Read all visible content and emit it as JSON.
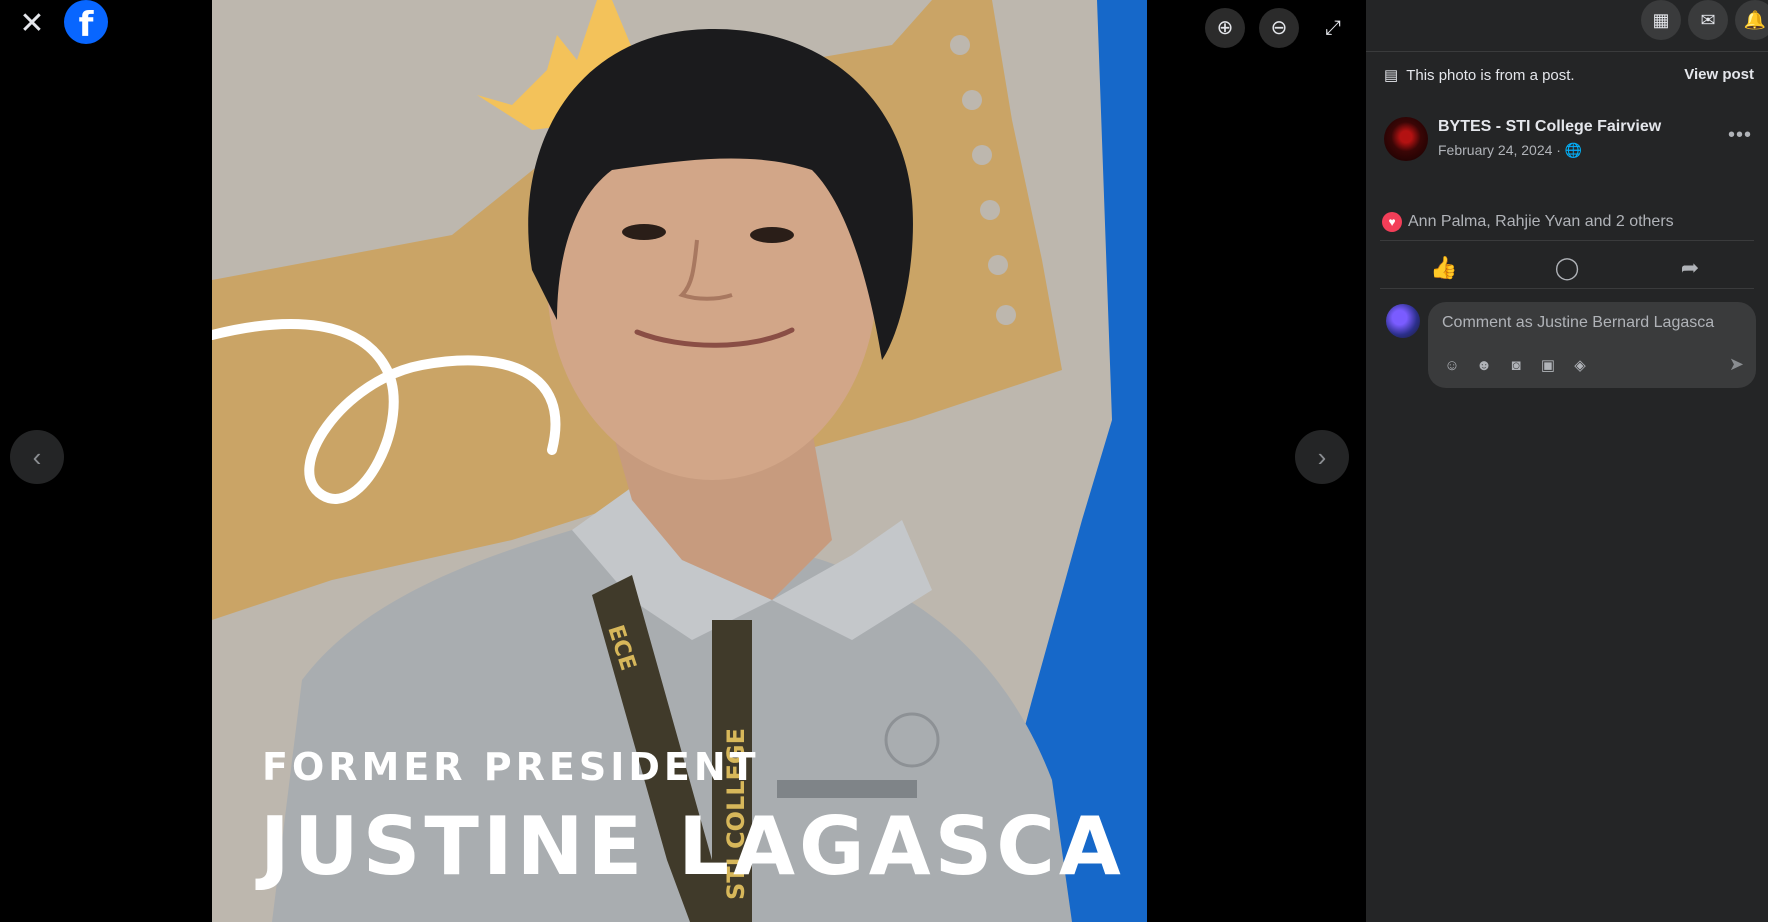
{
  "viewer": {
    "photo_text": {
      "line1": "FORMER PRESIDENT",
      "line2": "JUSTINE LAGASCA"
    },
    "lanyard_text": "STI COLLEGE",
    "lanyard_text_left": "ECE"
  },
  "panel": {
    "post_note": "This photo is from a post.",
    "view_post": "View post",
    "page_name": "BYTES - STI College Fairview",
    "page_date": "February 24, 2024 · 🌐",
    "more": "•••",
    "reactions_text": "Ann Palma, Rahjie Yvan and 2 others",
    "comment_placeholder": "Comment as Justine Bernard Lagasca"
  },
  "icons": {
    "close": "✕",
    "facebook": "f",
    "zoom_in": "⊕",
    "zoom_out": "⊖",
    "fullscreen": "⤢",
    "prev": "‹",
    "next": "›",
    "menu": "▦",
    "messenger": "✉",
    "notifications": "🔔",
    "like": "👍",
    "comment": "◯",
    "share": "➦",
    "heart": "♥",
    "send": "➤"
  },
  "colors": {
    "brand": "#0866ff",
    "panel_bg": "#242526",
    "reaction_heart": "#f33e58"
  }
}
